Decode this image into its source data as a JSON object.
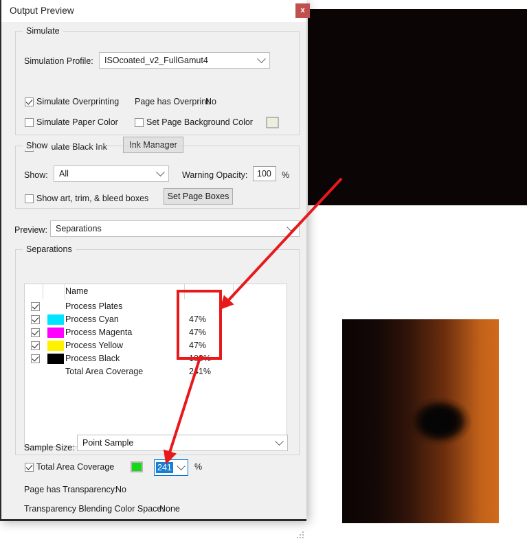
{
  "window": {
    "title": "Output Preview",
    "close_label": "x",
    "close_icon": "close-icon"
  },
  "simulate_group": {
    "title": "Simulate",
    "profile_label": "Simulation Profile:",
    "profile_value": "ISOcoated_v2_FullGamut4",
    "overprint_checkbox": {
      "label": "Simulate Overprinting",
      "checked": true
    },
    "page_has_overprint_label": "Page has Overprint:",
    "page_has_overprint_value": "No",
    "paper_color_checkbox": {
      "label": "Simulate Paper Color",
      "checked": false
    },
    "page_background_checkbox": {
      "label": "Set Page Background Color",
      "checked": false
    },
    "page_background_swatch_color": "#eeeedc",
    "black_ink_checkbox": {
      "label": "Simulate Black Ink",
      "checked": false
    },
    "ink_manager_button": "Ink Manager"
  },
  "show_group": {
    "title": "Show",
    "show_label": "Show:",
    "show_value": "All",
    "warning_opacity_label": "Warning Opacity:",
    "warning_opacity_value": "100",
    "warning_opacity_unit": "%",
    "boxes_checkbox": {
      "label": "Show art, trim, & bleed boxes",
      "checked": false
    },
    "set_page_boxes_button": "Set Page Boxes"
  },
  "preview": {
    "label": "Preview:",
    "value": "Separations"
  },
  "separations_group": {
    "title": "Separations",
    "column_header_name": "Name",
    "rows": [
      {
        "checked": true,
        "swatch": null,
        "name": "Process Plates",
        "percent": ""
      },
      {
        "checked": true,
        "swatch": "#00e5ff",
        "name": "Process Cyan",
        "percent": "47%"
      },
      {
        "checked": true,
        "swatch": "#ff00ff",
        "name": "Process Magenta",
        "percent": "47%"
      },
      {
        "checked": true,
        "swatch": "#fff200",
        "name": "Process Yellow",
        "percent": "47%"
      },
      {
        "checked": true,
        "swatch": "#000000",
        "name": "Process Black",
        "percent": "100%"
      },
      {
        "checked": null,
        "swatch": null,
        "name": "Total Area Coverage",
        "percent": "241%"
      }
    ]
  },
  "footer": {
    "sample_size_label": "Sample Size:",
    "sample_size_value": "Point Sample",
    "total_area_coverage_checkbox": {
      "label": "Total Area Coverage",
      "checked": true
    },
    "total_area_coverage_swatch_color": "#16d916",
    "total_area_coverage_value": "241",
    "total_area_coverage_unit": "%",
    "page_has_transparency_label": "Page has Transparency:",
    "page_has_transparency_value": "No",
    "blending_space_label": "Transparency Blending Color Space:",
    "blending_space_value": "None"
  },
  "annotations": {
    "highlight_color": "#e8191a",
    "highlight_box_label": "percent-column-highlight",
    "arrow_1": "arrow-from-preview-to-percent-column",
    "arrow_2": "arrow-from-total-area-coverage-to-input"
  }
}
